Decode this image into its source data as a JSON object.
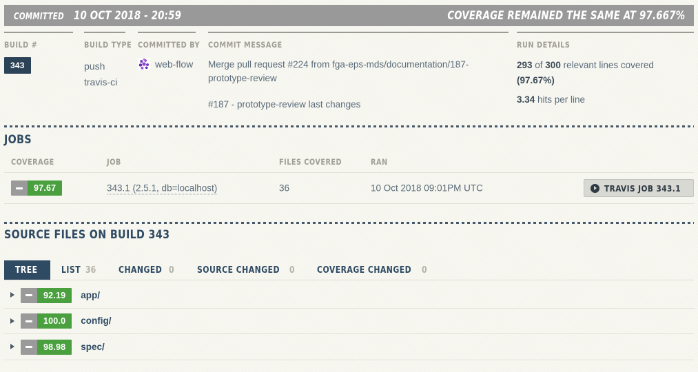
{
  "status_bar": {
    "committed_label": "COMMITTED",
    "committed_date": "10 OCT 2018 - 20:59",
    "coverage_summary": "COVERAGE REMAINED THE SAME AT 97.667%"
  },
  "build_info": {
    "build_number": {
      "label": "BUILD #",
      "value": "343"
    },
    "build_type": {
      "label": "BUILD TYPE",
      "line1": "push",
      "line2": "travis-ci"
    },
    "committed_by": {
      "label": "COMMITTED BY",
      "user": "web-flow"
    },
    "commit_message": {
      "label": "COMMIT MESSAGE",
      "line1": "Merge pull request #224 from fga-eps-mds/documentation/187-prototype-review",
      "line2": "#187 - prototype-review last changes"
    },
    "run_details": {
      "label": "RUN DETAILS",
      "covered_lines": "293",
      "of_text": " of ",
      "total_lines": "300",
      "relevant_text": " relevant lines covered ",
      "percent": "(97.67%)",
      "hits": "3.34",
      "hits_text": " hits per line"
    }
  },
  "jobs": {
    "heading": "JOBS",
    "columns": {
      "coverage": "COVERAGE",
      "job": "JOB",
      "files_covered": "FILES COVERED",
      "ran": "RAN"
    },
    "row": {
      "coverage_value": "97.67",
      "job_link": "343.1 (2.5.1, db=localhost)",
      "files_covered": "36",
      "ran": "10 Oct 2018 09:01PM UTC",
      "travis_button": "TRAVIS JOB 343.1"
    }
  },
  "source_files": {
    "heading": "SOURCE FILES ON BUILD 343",
    "tabs": [
      {
        "label": "TREE",
        "count": "",
        "active": true
      },
      {
        "label": "LIST",
        "count": "36",
        "active": false
      },
      {
        "label": "CHANGED",
        "count": "0",
        "active": false
      },
      {
        "label": "SOURCE CHANGED",
        "count": "0",
        "active": false
      },
      {
        "label": "COVERAGE CHANGED",
        "count": "0",
        "active": false
      }
    ],
    "tree_rows": [
      {
        "coverage": "92.19",
        "name": "app/"
      },
      {
        "coverage": "100.0",
        "name": "config/"
      },
      {
        "coverage": "98.98",
        "name": "spec/"
      }
    ]
  },
  "colors": {
    "header_gray": "#999999",
    "navy": "#2f4a63",
    "green": "#4aa03f",
    "badge_gray": "#9a9a9a",
    "background": "#f8f8f2"
  }
}
